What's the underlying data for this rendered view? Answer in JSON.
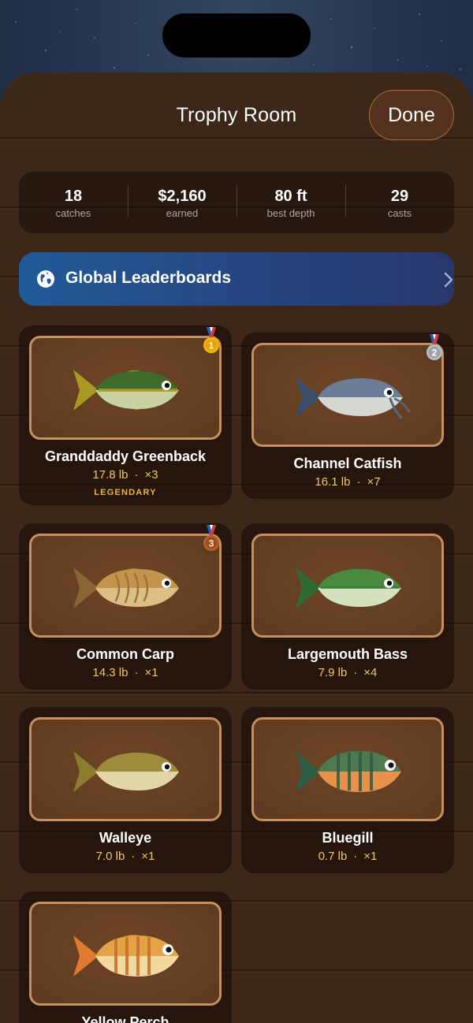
{
  "header": {
    "title": "Trophy Room",
    "done_label": "Done"
  },
  "stats": [
    {
      "value": "18",
      "label": "catches"
    },
    {
      "value": "$2,160",
      "label": "earned"
    },
    {
      "value": "80 ft",
      "label": "best depth"
    },
    {
      "value": "29",
      "label": "casts"
    }
  ],
  "leaderboard": {
    "label": "Global Leaderboards",
    "icon": "globe-icon"
  },
  "colors": {
    "accent_gold": "#f0c95a",
    "legendary": "#eab733",
    "leaderboard_blue": "#215a98"
  },
  "trophies": [
    {
      "name": "Granddaddy Greenback",
      "weight": "17.8 lb",
      "count": "×3",
      "tag": "LEGENDARY",
      "medal": "1"
    },
    {
      "name": "Channel Catfish",
      "weight": "16.1 lb",
      "count": "×7",
      "medal": "2"
    },
    {
      "name": "Common Carp",
      "weight": "14.3 lb",
      "count": "×1",
      "medal": "3"
    },
    {
      "name": "Largemouth Bass",
      "weight": "7.9 lb",
      "count": "×4"
    },
    {
      "name": "Walleye",
      "weight": "7.0 lb",
      "count": "×1"
    },
    {
      "name": "Bluegill",
      "weight": "0.7 lb",
      "count": "×1"
    },
    {
      "name": "Yellow Perch"
    }
  ],
  "separator": "·"
}
